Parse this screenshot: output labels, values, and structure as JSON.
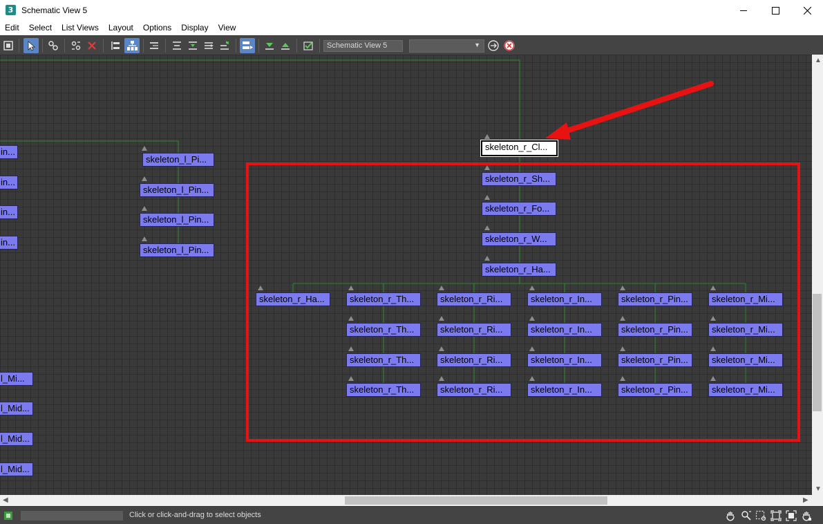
{
  "window": {
    "app_icon": "3",
    "title": "Schematic View 5",
    "icons": {
      "minimize": "minimize-icon",
      "maximize": "maximize-icon",
      "close": "close-icon"
    }
  },
  "menu": [
    "Edit",
    "Select",
    "List Views",
    "Layout",
    "Options",
    "Display",
    "View"
  ],
  "toolbar": {
    "view_name_value": "Schematic View 5",
    "view_dropdown_value": "",
    "colors": {
      "background": "#444444",
      "active": "#5a86c8"
    }
  },
  "canvas": {
    "colors": {
      "background": "#3a3a3a",
      "node": "#7b7bef",
      "wire": "#2f8a2f",
      "highlight": "#e81212"
    },
    "nodes": {
      "left_edge": [
        "in...",
        "in...",
        "in...",
        "in...",
        "l_Mi...",
        "l_Mid...",
        "l_Mid...",
        "l_Mid..."
      ],
      "left_pinky": [
        "skeleton_l_Pi...",
        "skeleton_l_Pin...",
        "skeleton_l_Pin...",
        "skeleton_l_Pin..."
      ],
      "selected": "skeleton_r_Cl...",
      "spine": [
        "skeleton_r_Sh...",
        "skeleton_r_Fo...",
        "skeleton_r_W...",
        "skeleton_r_Ha..."
      ],
      "hand_child": "skeleton_r_Ha...",
      "thumb": [
        "skeleton_r_Th...",
        "skeleton_r_Th...",
        "skeleton_r_Th...",
        "skeleton_r_Th..."
      ],
      "ring": [
        "skeleton_r_Ri...",
        "skeleton_r_Ri...",
        "skeleton_r_Ri...",
        "skeleton_r_Ri..."
      ],
      "index": [
        "skeleton_r_In...",
        "skeleton_r_In...",
        "skeleton_r_In...",
        "skeleton_r_In..."
      ],
      "pinky": [
        "skeleton_r_Pin...",
        "skeleton_r_Pin...",
        "skeleton_r_Pin...",
        "skeleton_r_Pin..."
      ],
      "middle": [
        "skeleton_r_Mi...",
        "skeleton_r_Mi...",
        "skeleton_r_Mi...",
        "skeleton_r_Mi..."
      ]
    }
  },
  "status": {
    "field_value": "",
    "message": "Click or click-and-drag to select objects"
  }
}
